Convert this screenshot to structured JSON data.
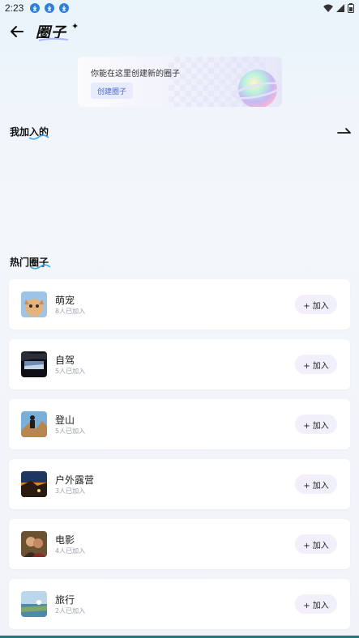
{
  "status_bar": {
    "time": "2:23"
  },
  "header": {
    "logo_text": "圈子"
  },
  "banner": {
    "text": "你能在这里创建新的圈子",
    "button_label": "创建圈子"
  },
  "sections": {
    "joined_title": "我加入的",
    "hot_title": "热门圈子"
  },
  "circles": [
    {
      "name": "萌宠",
      "count": "8人已加入",
      "join_label": "+ 加入"
    },
    {
      "name": "自驾",
      "count": "5人已加入",
      "join_label": "+ 加入"
    },
    {
      "name": "登山",
      "count": "5人已加入",
      "join_label": "+ 加入"
    },
    {
      "name": "户外露营",
      "count": "3人已加入",
      "join_label": "+ 加入"
    },
    {
      "name": "电影",
      "count": "4人已加入",
      "join_label": "+ 加入"
    },
    {
      "name": "旅行",
      "count": "2人已加入",
      "join_label": "+ 加入"
    }
  ],
  "icons": [
    "download-icon",
    "wifi-icon",
    "signal-icon",
    "battery-icon",
    "back-arrow-icon",
    "sparkle-icon",
    "planet-icon",
    "arrow-right-icon"
  ],
  "colors": {
    "accent": "#4a67c9",
    "join_button_bg": "#f2eefa"
  }
}
